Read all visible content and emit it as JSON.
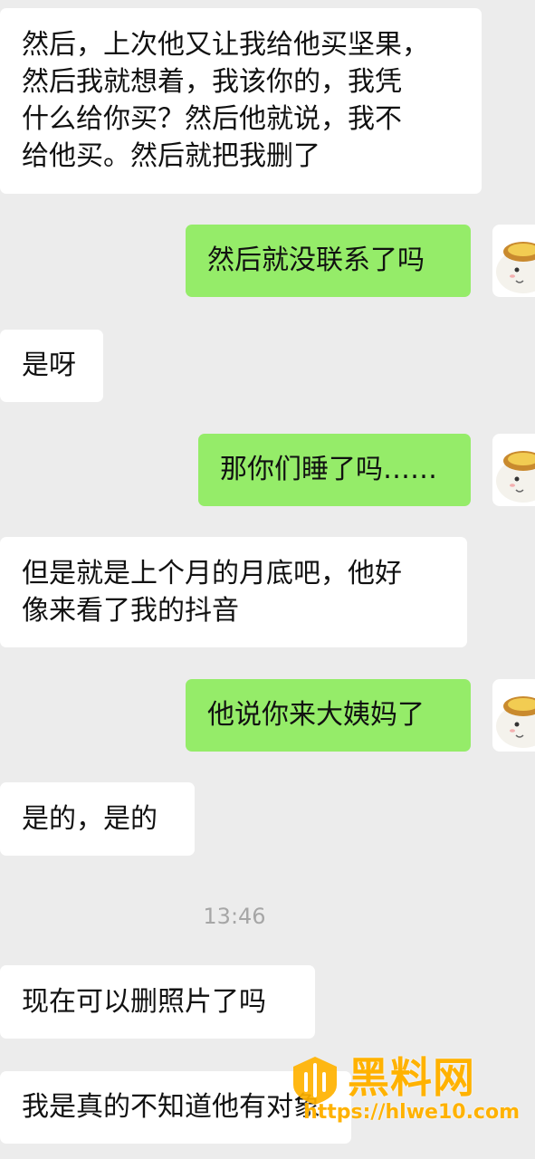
{
  "messages": [
    {
      "side": "in",
      "text": "然后，上次他又让我给他买坚果，\n然后我就想着，我该你的，我凭\n什么给你买？然后他就说，我不\n给他买。然后就把我删了"
    },
    {
      "side": "out",
      "text": "然后就没联系了吗"
    },
    {
      "side": "in",
      "text": "是呀"
    },
    {
      "side": "out",
      "text": "那你们睡了吗……"
    },
    {
      "side": "in",
      "text": "但是就是上个月的月底吧，他好\n像来看了我的抖音"
    },
    {
      "side": "out",
      "text": "他说你来大姨妈了"
    },
    {
      "side": "in",
      "text": "是的，是的"
    },
    {
      "side": "in",
      "text": "现在可以删照片了吗"
    },
    {
      "side": "in",
      "text": "我是真的不知道他有对象"
    }
  ],
  "timestamp": "13:46",
  "avatar": {
    "icon": "egg-tart-cartoon-avatar-icon"
  },
  "colors": {
    "background": "#ececec",
    "incoming_bubble": "#ffffff",
    "outgoing_bubble": "#95ec69",
    "timestamp": "#a6a6a6",
    "watermark": "#ffb200"
  },
  "watermark": {
    "title": "黑料网",
    "url": "https://hlwe10.com",
    "icon": "watermark-logo-icon"
  }
}
